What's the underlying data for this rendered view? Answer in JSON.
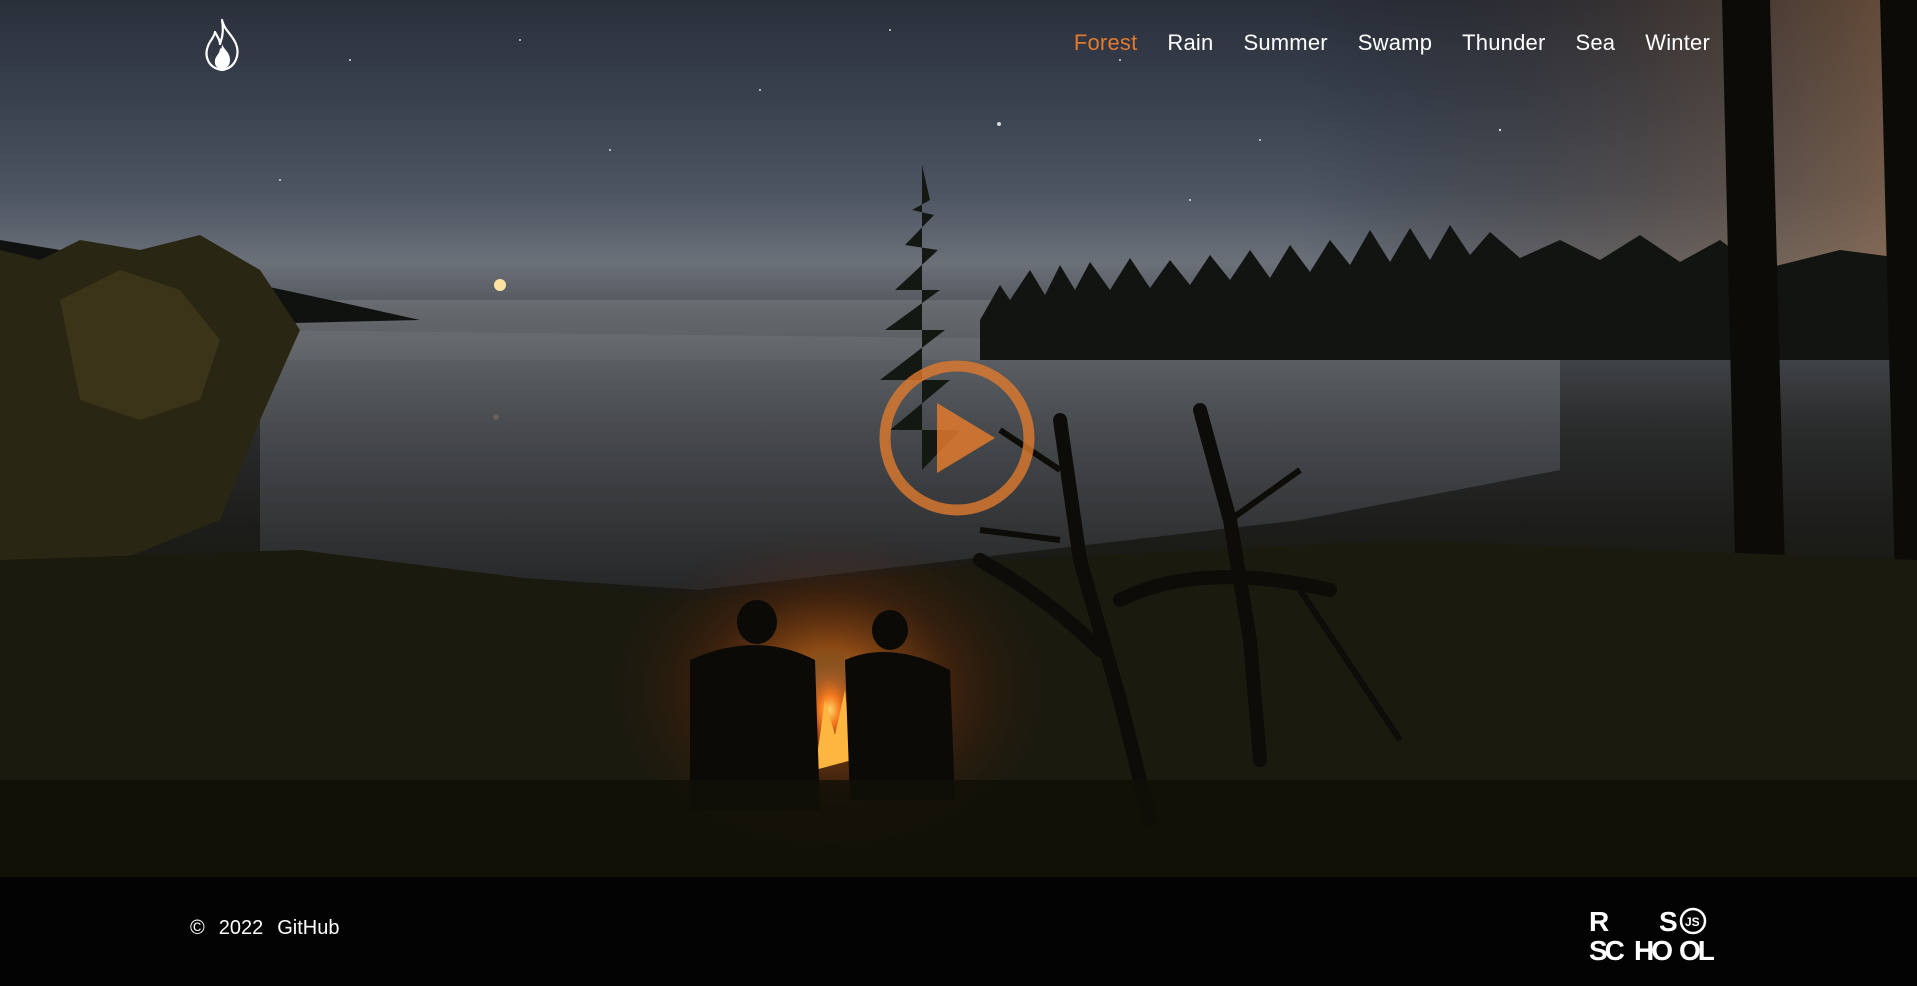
{
  "nav": {
    "items": [
      {
        "label": "Forest",
        "active": true
      },
      {
        "label": "Rain",
        "active": false
      },
      {
        "label": "Summer",
        "active": false
      },
      {
        "label": "Swamp",
        "active": false
      },
      {
        "label": "Thunder",
        "active": false
      },
      {
        "label": "Sea",
        "active": false
      },
      {
        "label": "Winter",
        "active": false
      }
    ]
  },
  "logo": {
    "icon": "flame-icon"
  },
  "player": {
    "icon": "play-icon",
    "color": "#e07a2e"
  },
  "footer": {
    "copyright_symbol": "©",
    "year": "2022",
    "github_label": "GitHub",
    "school_logo": {
      "icon": "rs-school-logo",
      "letters": [
        "R",
        "S",
        "SC",
        "HO",
        "OL",
        "JS"
      ]
    }
  },
  "colors": {
    "accent": "#e07a2e",
    "text": "#ffffff",
    "footer_bg": "#030303"
  }
}
